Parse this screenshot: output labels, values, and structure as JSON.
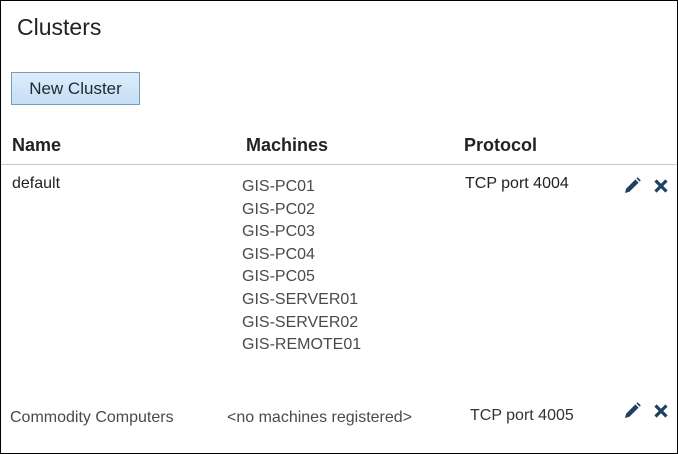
{
  "page": {
    "title": "Clusters"
  },
  "toolbar": {
    "new_cluster_label": "New Cluster"
  },
  "table": {
    "headers": {
      "name": "Name",
      "machines": "Machines",
      "protocol": "Protocol"
    },
    "rows": [
      {
        "name": "default",
        "machines": [
          "GIS-PC01",
          "GIS-PC02",
          "GIS-PC03",
          "GIS-PC04",
          "GIS-PC05",
          "GIS-SERVER01",
          "GIS-SERVER02",
          "GIS-REMOTE01"
        ],
        "machines_text": "",
        "protocol": "TCP port 4004",
        "actions": [
          "pencil-icon",
          "close-icon"
        ]
      },
      {
        "name": "Commodity Computers",
        "machines": [],
        "machines_text": "<no machines registered>",
        "protocol": "TCP port 4005",
        "actions": [
          "pencil-icon",
          "close-icon"
        ]
      }
    ]
  },
  "colors": {
    "icon": "#1f3f63",
    "button_border": "#7a9ab5",
    "button_fill": "#c4def4",
    "rule": "#c8c8c8"
  }
}
